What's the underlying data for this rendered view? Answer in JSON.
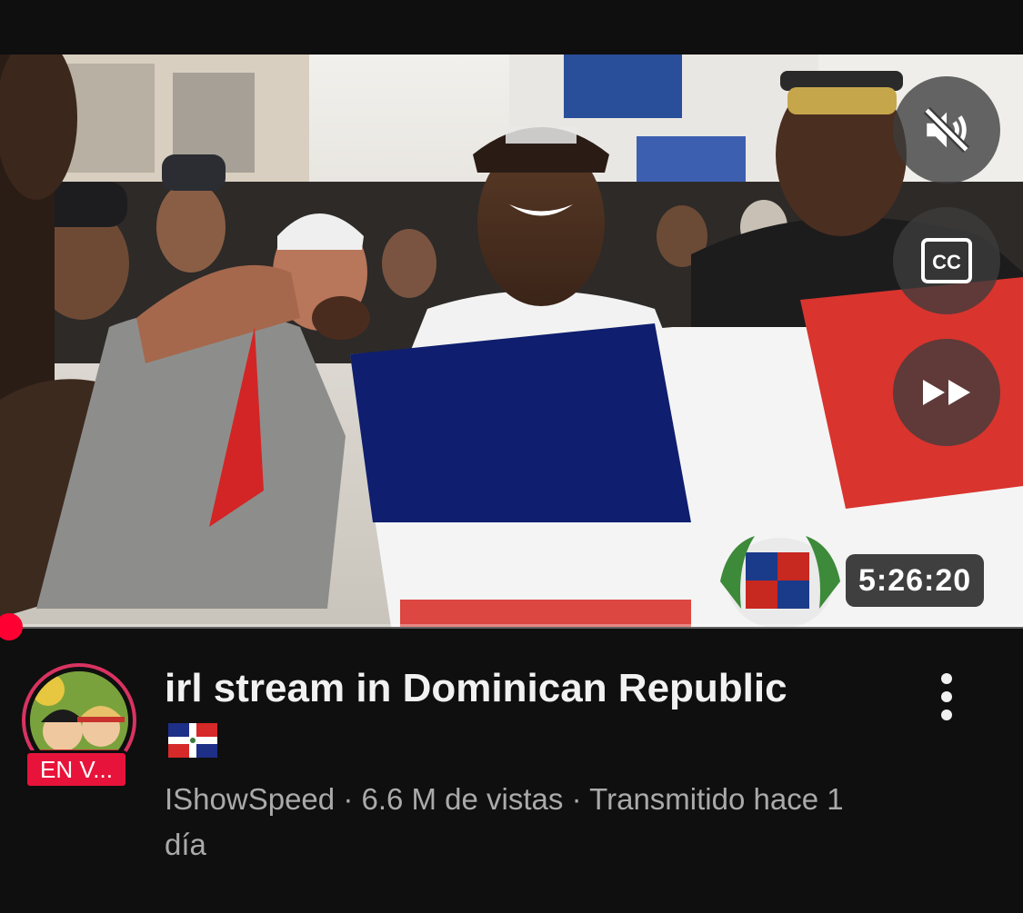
{
  "video": {
    "title": "irl stream in Dominican Republic",
    "title_emoji": "🇩🇴",
    "channel": "IShowSpeed",
    "views": "6.6 M de vistas",
    "separator": "·",
    "status": "Transmitido hace 1 día",
    "duration": "5:26:20",
    "live_badge": "EN V...",
    "progress_fraction": 0.0
  },
  "controls": {
    "mute_icon": "volume-muted-icon",
    "captions_icon": "closed-captions-icon",
    "captions_label": "CC",
    "fast_forward_icon": "fast-forward-icon"
  },
  "colors": {
    "background": "#0f0f0f",
    "progress": "#ff0000",
    "live_badge": "#e8133a",
    "avatar_ring": "#d93361",
    "secondary_text": "#aaaaaa"
  }
}
